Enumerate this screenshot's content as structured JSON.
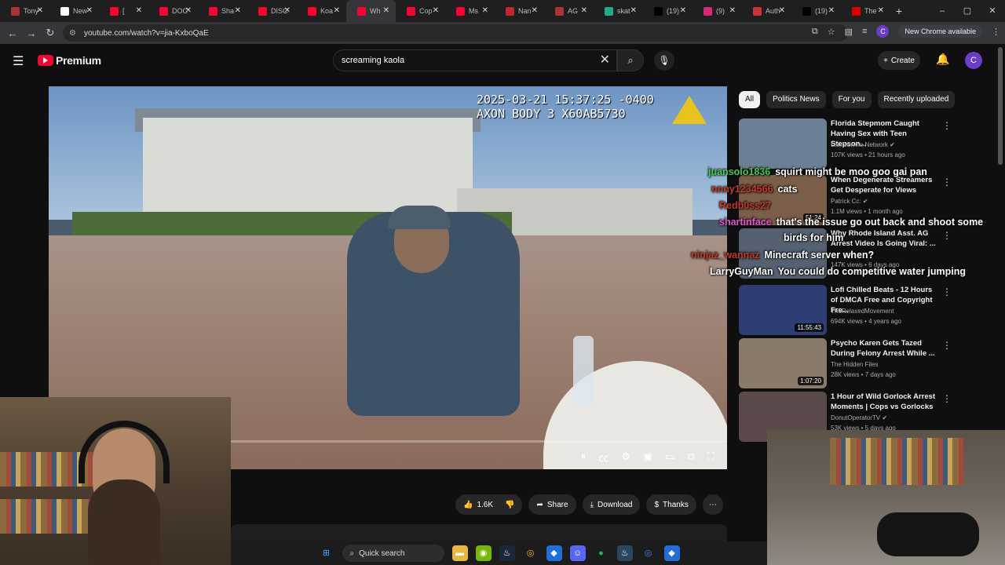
{
  "browser": {
    "tabs": [
      {
        "title": "Tony",
        "color": "#a33"
      },
      {
        "title": "New",
        "color": "#fff"
      },
      {
        "title": "[",
        "color": "#ff0033"
      },
      {
        "title": "DOC",
        "color": "#ff0033"
      },
      {
        "title": "Sha",
        "color": "#ff0033"
      },
      {
        "title": "DISC",
        "color": "#ff0033"
      },
      {
        "title": "Koa",
        "color": "#ff0033"
      },
      {
        "title": "Wh",
        "color": "#ff0033",
        "active": true
      },
      {
        "title": "Cop",
        "color": "#ff0033"
      },
      {
        "title": "Ms",
        "color": "#ff0033"
      },
      {
        "title": "Nan",
        "color": "#c1272d"
      },
      {
        "title": "AG",
        "color": "#a33"
      },
      {
        "title": "skat",
        "color": "#2a8"
      },
      {
        "title": "(19)",
        "color": "#000"
      },
      {
        "title": "(9)",
        "color": "#d62976"
      },
      {
        "title": "Auth",
        "color": "#c33"
      },
      {
        "title": "(19)",
        "color": "#000"
      },
      {
        "title": "The",
        "color": "#d00"
      }
    ],
    "url": "youtube.com/watch?v=jia-KxboQaE",
    "new_chrome_label": "New Chrome available",
    "profile_initial": "C"
  },
  "youtube": {
    "logo_text": "Premium",
    "search_value": "screaming kaola",
    "create_label": "Create",
    "avatar_initial": "C",
    "video": {
      "overlay_line1": "2025-03-21 15:37:25 -0400",
      "overlay_line2": "AXON BODY 3 X60AB5730"
    },
    "actions": {
      "likes": "1.6K",
      "share": "Share",
      "download": "Download",
      "thanks": "Thanks"
    },
    "chips": [
      "All",
      "Politics News",
      "For you",
      "Recently uploaded"
    ],
    "recommendations": [
      {
        "title": "Florida Stepmom Caught Having Sex with Teen Stepson...",
        "channel": "Law&Crime Network ✔",
        "meta": "107K views • 21 hours ago",
        "duration": "",
        "color": "#6b7f95"
      },
      {
        "title": "When Degenerate Streamers Get Desperate for Views",
        "channel": "Patrick Cc: ✔",
        "meta": "1.1M views • 1 month ago",
        "duration": "51:24",
        "color": "#7a5e4a"
      },
      {
        "title": "Why Rhode Island Asst. AG Arrest Video Is Going Viral: ...",
        "channel": "",
        "meta": "147K views • 6 days ago",
        "duration": "",
        "color": "#556070"
      },
      {
        "title": "Lofi Chilled Beats - 12 Hours of DMCA Free and Copyright Fre...",
        "channel": "TheRelaxedMovement",
        "meta": "694K views • 4 years ago",
        "duration": "11:55:43",
        "color": "#2c3e73"
      },
      {
        "title": "Psycho Karen Gets Tazed During Felony Arrest While ...",
        "channel": "The Hidden Files",
        "meta": "28K views • 7 days ago",
        "duration": "1:07:20",
        "color": "#8a7a6a"
      },
      {
        "title": "1 Hour of Wild Gorlock Arrest Moments | Cops vs Gorlocks",
        "channel": "DonutOperatorTV ✔",
        "meta": "53K views • 5 days ago",
        "duration": "",
        "color": "#5a4a4a"
      }
    ]
  },
  "chat": [
    {
      "user": "juansolo1836",
      "msg": "squirt might be moo goo gai pan",
      "color": "#3ecf4a"
    },
    {
      "user": "nnny1234566",
      "msg": "cats",
      "color": "#c0392b"
    },
    {
      "user": "Redb0ss27",
      "msg": "",
      "color": "#c0392b"
    },
    {
      "user": "shartinface",
      "msg": "that's the issue go out back and shoot some",
      "color": "#e056c8"
    },
    {
      "user": "",
      "msg": "birds for him",
      "color": "#fff"
    },
    {
      "user": "ninjaz_wannaz",
      "msg": "Minecraft server when?",
      "color": "#c0392b"
    },
    {
      "user": "LarryGuyMan",
      "msg": "You could do competitive water jumping",
      "color": "#ffffff"
    }
  ],
  "taskbar": {
    "search_label": "Quick search"
  }
}
